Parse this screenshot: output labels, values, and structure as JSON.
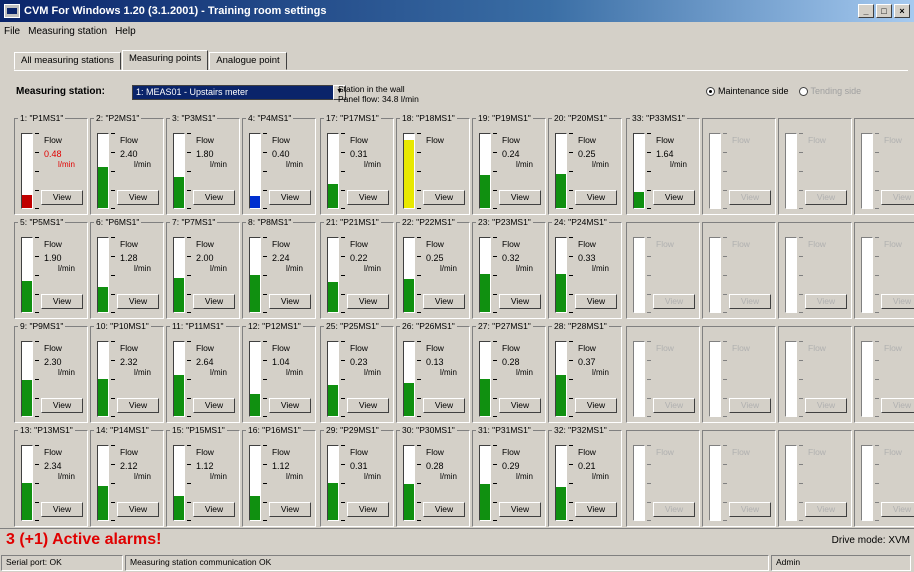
{
  "window": {
    "title": "CVM For Windows 1.20 (3.1.2001) - Training room settings",
    "controls": [
      "_",
      "□",
      "×"
    ]
  },
  "menu": [
    "File",
    "Measuring station",
    "Help"
  ],
  "tabs": [
    {
      "label": "All measuring stations",
      "active": false
    },
    {
      "label": "Measuring points",
      "active": true
    },
    {
      "label": "Analogue point",
      "active": false
    }
  ],
  "station": {
    "label": "Measuring station:",
    "selected": "1: MEAS01 - Upstairs meter",
    "info_line1": "Station in the wall",
    "info_line2": "Panel flow: 34.8 l/min"
  },
  "side_options": [
    {
      "label": "Maintenance side",
      "selected": true,
      "enabled": true
    },
    {
      "label": "Tending side",
      "selected": false,
      "enabled": false
    }
  ],
  "points": [
    {
      "title": "1: \"P1MS1\"",
      "value": "0.48",
      "unit": "l/min",
      "level": 0.18,
      "color": "#c00000",
      "value_color": "#e00000",
      "view": "View",
      "flow": "Flow",
      "state": "alarm"
    },
    {
      "title": "2: \"P2MS1\"",
      "value": "2.40",
      "unit": "l/min",
      "level": 0.55,
      "color": "#109010",
      "view": "View",
      "flow": "Flow",
      "state": "normal"
    },
    {
      "title": "3: \"P3MS1\"",
      "value": "1.80",
      "unit": "l/min",
      "level": 0.42,
      "color": "#109010",
      "view": "View",
      "flow": "Flow",
      "state": "normal"
    },
    {
      "title": "4: \"P4MS1\"",
      "value": "0.40",
      "unit": "l/min",
      "level": 0.16,
      "color": "#0030d0",
      "view": "View",
      "flow": "Flow",
      "state": "low"
    },
    {
      "title": "17: \"P17MS1\"",
      "value": "0.31",
      "unit": "l/min",
      "level": 0.32,
      "color": "#109010",
      "view": "View",
      "flow": "Flow",
      "state": "normal"
    },
    {
      "title": "18: \"P18MS1\"",
      "value": "",
      "unit": "",
      "level": 0.92,
      "color": "#e8e800",
      "view": "View",
      "flow": "Flow",
      "state": "warning"
    },
    {
      "title": "19: \"P19MS1\"",
      "value": "0.24",
      "unit": "l/min",
      "level": 0.45,
      "color": "#109010",
      "view": "View",
      "flow": "Flow",
      "state": "normal"
    },
    {
      "title": "20: \"P20MS1\"",
      "value": "0.25",
      "unit": "l/min",
      "level": 0.46,
      "color": "#109010",
      "view": "View",
      "flow": "Flow",
      "state": "normal"
    },
    {
      "title": "33: \"P33MS1\"",
      "value": "1.64",
      "unit": "l/min",
      "level": 0.22,
      "color": "#109010",
      "view": "View",
      "flow": "Flow",
      "state": "normal"
    },
    {
      "title": "",
      "value": "",
      "unit": "",
      "level": 0,
      "color": "",
      "view": "View",
      "flow": "Flow",
      "state": "empty"
    },
    {
      "title": "",
      "value": "",
      "unit": "",
      "level": 0,
      "color": "",
      "view": "View",
      "flow": "Flow",
      "state": "empty"
    },
    {
      "title": "",
      "value": "",
      "unit": "",
      "level": 0,
      "color": "",
      "view": "View",
      "flow": "Flow",
      "state": "empty"
    },
    {
      "title": "5: \"P5MS1\"",
      "value": "1.90",
      "unit": "l/min",
      "level": 0.42,
      "color": "#109010",
      "view": "View",
      "flow": "Flow",
      "state": "normal"
    },
    {
      "title": "6: \"P6MS1\"",
      "value": "1.28",
      "unit": "l/min",
      "level": 0.34,
      "color": "#109010",
      "view": "View",
      "flow": "Flow",
      "state": "normal"
    },
    {
      "title": "7: \"P7MS1\"",
      "value": "2.00",
      "unit": "l/min",
      "level": 0.46,
      "color": "#109010",
      "view": "View",
      "flow": "Flow",
      "state": "normal"
    },
    {
      "title": "8: \"P8MS1\"",
      "value": "2.24",
      "unit": "l/min",
      "level": 0.5,
      "color": "#109010",
      "view": "View",
      "flow": "Flow",
      "state": "normal"
    },
    {
      "title": "21: \"P21MS1\"",
      "value": "0.22",
      "unit": "l/min",
      "level": 0.4,
      "color": "#109010",
      "view": "View",
      "flow": "Flow",
      "state": "normal"
    },
    {
      "title": "22: \"P22MS1\"",
      "value": "0.25",
      "unit": "l/min",
      "level": 0.45,
      "color": "#109010",
      "view": "View",
      "flow": "Flow",
      "state": "normal"
    },
    {
      "title": "23: \"P23MS1\"",
      "value": "0.32",
      "unit": "l/min",
      "level": 0.52,
      "color": "#109010",
      "view": "View",
      "flow": "Flow",
      "state": "normal"
    },
    {
      "title": "24: \"P24MS1\"",
      "value": "0.33",
      "unit": "l/min",
      "level": 0.52,
      "color": "#109010",
      "view": "View",
      "flow": "Flow",
      "state": "normal"
    },
    {
      "title": "",
      "value": "",
      "unit": "",
      "level": 0,
      "color": "",
      "view": "View",
      "flow": "Flow",
      "state": "empty"
    },
    {
      "title": "",
      "value": "",
      "unit": "",
      "level": 0,
      "color": "",
      "view": "View",
      "flow": "Flow",
      "state": "empty"
    },
    {
      "title": "",
      "value": "",
      "unit": "",
      "level": 0,
      "color": "",
      "view": "View",
      "flow": "Flow",
      "state": "empty"
    },
    {
      "title": "",
      "value": "",
      "unit": "",
      "level": 0,
      "color": "",
      "view": "View",
      "flow": "Flow",
      "state": "empty"
    },
    {
      "title": "9: \"P9MS1\"",
      "value": "2.30",
      "unit": "l/min",
      "level": 0.48,
      "color": "#109010",
      "view": "View",
      "flow": "Flow",
      "state": "normal"
    },
    {
      "title": "10: \"P10MS1\"",
      "value": "2.32",
      "unit": "l/min",
      "level": 0.5,
      "color": "#109010",
      "view": "View",
      "flow": "Flow",
      "state": "normal"
    },
    {
      "title": "11: \"P11MS1\"",
      "value": "2.64",
      "unit": "l/min",
      "level": 0.56,
      "color": "#109010",
      "view": "View",
      "flow": "Flow",
      "state": "normal"
    },
    {
      "title": "12: \"P12MS1\"",
      "value": "1.04",
      "unit": "l/min",
      "level": 0.3,
      "color": "#109010",
      "view": "View",
      "flow": "Flow",
      "state": "normal"
    },
    {
      "title": "25: \"P25MS1\"",
      "value": "0.23",
      "unit": "l/min",
      "level": 0.42,
      "color": "#109010",
      "view": "View",
      "flow": "Flow",
      "state": "normal"
    },
    {
      "title": "26: \"P26MS1\"",
      "value": "0.13",
      "unit": "l/min",
      "level": 0.45,
      "color": "#109010",
      "view": "View",
      "flow": "Flow",
      "state": "normal"
    },
    {
      "title": "27: \"P27MS1\"",
      "value": "0.28",
      "unit": "l/min",
      "level": 0.5,
      "color": "#109010",
      "view": "View",
      "flow": "Flow",
      "state": "normal"
    },
    {
      "title": "28: \"P28MS1\"",
      "value": "0.37",
      "unit": "l/min",
      "level": 0.55,
      "color": "#109010",
      "view": "View",
      "flow": "Flow",
      "state": "normal"
    },
    {
      "title": "",
      "value": "",
      "unit": "",
      "level": 0,
      "color": "",
      "view": "View",
      "flow": "Flow",
      "state": "empty"
    },
    {
      "title": "",
      "value": "",
      "unit": "",
      "level": 0,
      "color": "",
      "view": "View",
      "flow": "Flow",
      "state": "empty"
    },
    {
      "title": "",
      "value": "",
      "unit": "",
      "level": 0,
      "color": "",
      "view": "View",
      "flow": "Flow",
      "state": "empty"
    },
    {
      "title": "",
      "value": "",
      "unit": "",
      "level": 0,
      "color": "",
      "view": "View",
      "flow": "Flow",
      "state": "empty"
    },
    {
      "title": "13: \"P13MS1\"",
      "value": "2.34",
      "unit": "l/min",
      "level": 0.5,
      "color": "#109010",
      "view": "View",
      "flow": "Flow",
      "state": "normal"
    },
    {
      "title": "14: \"P14MS1\"",
      "value": "2.12",
      "unit": "l/min",
      "level": 0.46,
      "color": "#109010",
      "view": "View",
      "flow": "Flow",
      "state": "normal"
    },
    {
      "title": "15: \"P15MS1\"",
      "value": "1.12",
      "unit": "l/min",
      "level": 0.32,
      "color": "#109010",
      "view": "View",
      "flow": "Flow",
      "state": "normal"
    },
    {
      "title": "16: \"P16MS1\"",
      "value": "1.12",
      "unit": "l/min",
      "level": 0.32,
      "color": "#109010",
      "view": "View",
      "flow": "Flow",
      "state": "normal"
    },
    {
      "title": "29: \"P29MS1\"",
      "value": "0.31",
      "unit": "l/min",
      "level": 0.5,
      "color": "#109010",
      "view": "View",
      "flow": "Flow",
      "state": "normal"
    },
    {
      "title": "30: \"P30MS1\"",
      "value": "0.28",
      "unit": "l/min",
      "level": 0.48,
      "color": "#109010",
      "view": "View",
      "flow": "Flow",
      "state": "normal"
    },
    {
      "title": "31: \"P31MS1\"",
      "value": "0.29",
      "unit": "l/min",
      "level": 0.48,
      "color": "#109010",
      "view": "View",
      "flow": "Flow",
      "state": "normal"
    },
    {
      "title": "32: \"P32MS1\"",
      "value": "0.21",
      "unit": "l/min",
      "level": 0.44,
      "color": "#109010",
      "view": "View",
      "flow": "Flow",
      "state": "normal"
    },
    {
      "title": "",
      "value": "",
      "unit": "",
      "level": 0,
      "color": "",
      "view": "View",
      "flow": "Flow",
      "state": "empty"
    },
    {
      "title": "",
      "value": "",
      "unit": "",
      "level": 0,
      "color": "",
      "view": "View",
      "flow": "Flow",
      "state": "empty"
    },
    {
      "title": "",
      "value": "",
      "unit": "",
      "level": 0,
      "color": "",
      "view": "View",
      "flow": "Flow",
      "state": "empty"
    },
    {
      "title": "",
      "value": "",
      "unit": "",
      "level": 0,
      "color": "",
      "view": "View",
      "flow": "Flow",
      "state": "empty"
    }
  ],
  "alarm": {
    "text": "3 (+1) Active alarms!",
    "color": "#e00000"
  },
  "drive_mode": "Drive mode: XVM",
  "status": {
    "port": "Serial port: OK",
    "message": "Measuring station communication OK",
    "user": "Admin"
  }
}
